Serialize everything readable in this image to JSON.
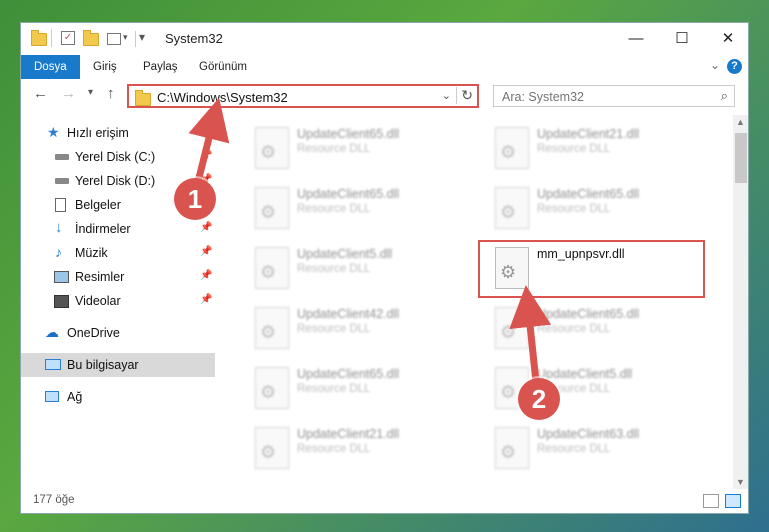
{
  "window": {
    "title": "System32",
    "minimize": "—",
    "maximize": "☐",
    "close": "✕"
  },
  "ribbon": {
    "tabs": [
      "Dosya",
      "Giriş",
      "Paylaş",
      "Görünüm"
    ]
  },
  "nav": {
    "address": "C:\\Windows\\System32",
    "search_placeholder": "Ara: System32"
  },
  "sidebar": {
    "items": [
      {
        "label": "Hızlı erişim",
        "icon": "star-icon"
      },
      {
        "label": "Yerel Disk (C:)",
        "icon": "drive-icon"
      },
      {
        "label": "Yerel Disk (D:)",
        "icon": "drive-icon"
      },
      {
        "label": "Belgeler",
        "icon": "documents-icon"
      },
      {
        "label": "İndirmeler",
        "icon": "download-icon"
      },
      {
        "label": "Müzik",
        "icon": "music-icon"
      },
      {
        "label": "Resimler",
        "icon": "pictures-icon"
      },
      {
        "label": "Videolar",
        "icon": "videos-icon"
      },
      {
        "label": "OneDrive",
        "icon": "cloud-icon"
      },
      {
        "label": "Bu bilgisayar",
        "icon": "computer-icon"
      },
      {
        "label": "Ağ",
        "icon": "network-icon"
      }
    ]
  },
  "files": [
    {
      "name": "UpdateClient65.dll",
      "type": "Resource DLL"
    },
    {
      "name": "UpdateClient21.dll",
      "type": "Resource DLL"
    },
    {
      "name": "UpdateClient65.dll",
      "type": "Resource DLL"
    },
    {
      "name": "UpdateClient65.dll",
      "type": "Resource DLL"
    },
    {
      "name": "UpdateClient5.dll",
      "type": "Resource DLL"
    },
    {
      "name": "mm_upnpsvr.dll",
      "type": ""
    },
    {
      "name": "UpdateClient42.dll",
      "type": "Resource DLL"
    },
    {
      "name": "UpdateClient65.dll",
      "type": "Resource DLL"
    },
    {
      "name": "UpdateClient65.dll",
      "type": "Resource DLL"
    },
    {
      "name": "UpdateClient5.dll",
      "type": "Resource DLL"
    },
    {
      "name": "UpdateClient21.dll",
      "type": "Resource DLL"
    },
    {
      "name": "UpdateClient63.dll",
      "type": "Resource DLL"
    }
  ],
  "status": {
    "count": "177 öğe"
  },
  "annotations": {
    "badge1": "1",
    "badge2": "2"
  },
  "colors": {
    "accent": "#1979ca",
    "highlight": "#d9534f"
  }
}
